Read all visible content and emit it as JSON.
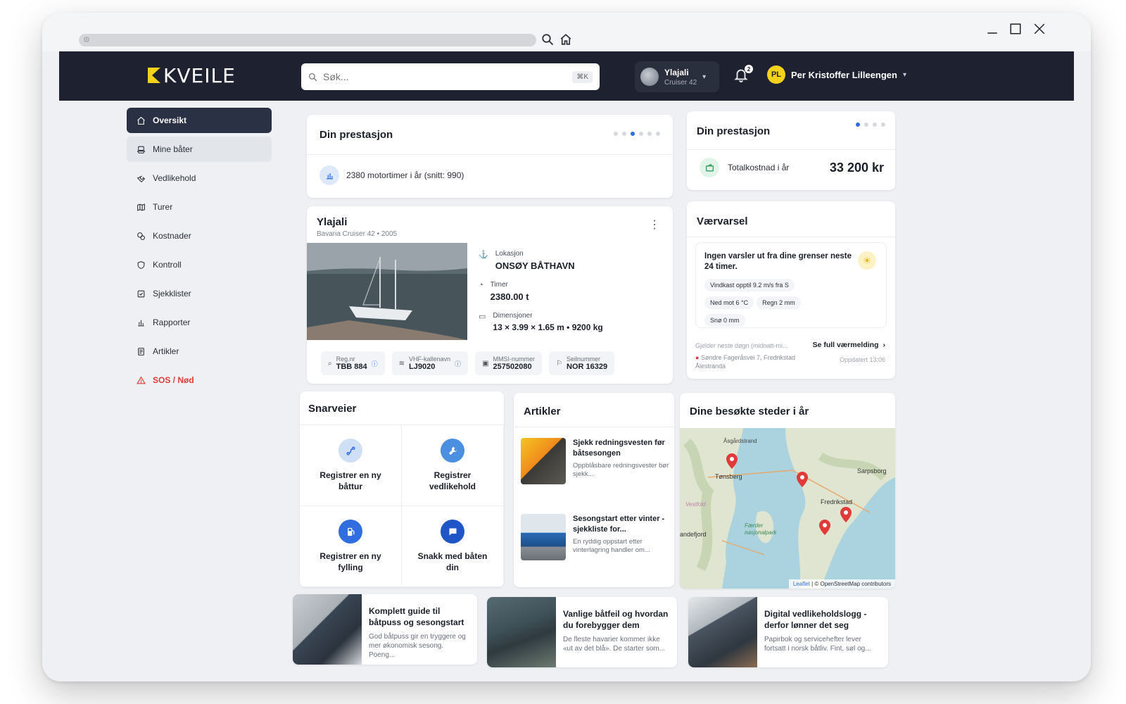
{
  "app": {
    "logo_text": "KVEILE",
    "search_placeholder": "Søk...",
    "search_shortcut": "⌘K",
    "boat_switch": {
      "name": "Ylajali",
      "model": "Cruiser 42"
    },
    "notifications_count": "2",
    "user": {
      "initials": "PL",
      "name": "Per Kristoffer Lilleengen"
    }
  },
  "sidebar": {
    "items": [
      {
        "label": "Oversikt",
        "icon": "home-icon"
      },
      {
        "label": "Mine båter",
        "icon": "boat-icon"
      },
      {
        "label": "Vedlikehold",
        "icon": "wrench-icon"
      },
      {
        "label": "Turer",
        "icon": "map-icon"
      },
      {
        "label": "Kostnader",
        "icon": "coins-icon"
      },
      {
        "label": "Kontroll",
        "icon": "shield-icon"
      },
      {
        "label": "Sjekklister",
        "icon": "checklist-icon"
      },
      {
        "label": "Rapporter",
        "icon": "chart-icon"
      },
      {
        "label": "Artikler",
        "icon": "article-icon"
      },
      {
        "label": "SOS / Nød",
        "icon": "warning-icon"
      }
    ]
  },
  "performance_left": {
    "title": "Din prestasjon",
    "text": "2380 motortimer i år (snitt: 990)",
    "dots_total": 6,
    "dots_active": 3
  },
  "performance_right": {
    "title": "Din prestasjon",
    "label": "Totalkostnad i år",
    "value": "33 200 kr",
    "dots_total": 4,
    "dots_active": 1
  },
  "boat": {
    "name": "Ylajali",
    "subtitle": "Bavaria Cruiser 42 • 2005",
    "location_label": "Lokasjon",
    "location_value": "ONSØY BÅTHAVN",
    "hours_label": "Timer",
    "hours_value": "2380.00 t",
    "dims_label": "Dimensjoner",
    "dims_value": "13 × 3.99 × 1.65 m • 9200 kg",
    "pills": [
      {
        "label": "Reg.nr",
        "value": "TBB 884"
      },
      {
        "label": "VHF-kallenavn",
        "value": "LJ9020"
      },
      {
        "label": "MMSI-nummer",
        "value": "257502080"
      },
      {
        "label": "Seilnummer",
        "value": "NOR 16329"
      }
    ]
  },
  "weather": {
    "title": "Værvarsel",
    "headline": "Ingen varsler ut fra dine grenser neste 24 timer.",
    "chips": [
      "Vindkast opptil 9.2 m/s fra S",
      "Ned mot 6 °C",
      "Regn 2 mm",
      "Snø 0 mm"
    ],
    "footnote": "Gjelder neste døgn (midnatt-mi...",
    "link": "Se full værmelding",
    "address": "Søndre Fageråsvei 7, Fredrikstad",
    "address2": "Ålestranda",
    "updated": "Oppdatert 13:06"
  },
  "shortcuts": {
    "title": "Snarveier",
    "items": [
      {
        "label": "Registrer en ny båttur",
        "icon": "route-icon",
        "color": "#cfe0f6"
      },
      {
        "label": "Registrer vedlikehold",
        "icon": "wrench-icon",
        "color": "#4a8fe0"
      },
      {
        "label": "Registrer en ny fylling",
        "icon": "fuel-icon",
        "color": "#2f6de1"
      },
      {
        "label": "Snakk med båten din",
        "icon": "chat-icon",
        "color": "#1f55c7"
      }
    ]
  },
  "articles": {
    "title": "Artikler",
    "items": [
      {
        "title": "Sjekk redningsvesten før båtsesongen",
        "summary": "Oppblåsbare redningsvester bør sjekk..."
      },
      {
        "title": "Sesongstart etter vinter - sjekkliste for...",
        "summary": "En ryddig oppstart etter vinterlagring handler om..."
      }
    ]
  },
  "places": {
    "title": "Dine besøkte steder i år",
    "labels": [
      "Åsgårdstrand",
      "Tønsberg",
      "Sarpsborg",
      "Fredrikstad",
      "Vestfold",
      "Færder nasjonalpark",
      "andefjord"
    ],
    "attribution_leaflet": "Leaflet",
    "attribution_rest": "| © OpenStreetMap contributors"
  },
  "bottom_articles": [
    {
      "title": "Komplett guide til båtpuss og sesongstart",
      "summary": "God båtpuss gir en tryggere og mer økonomisk sesong. Poeng..."
    },
    {
      "title": "Vanlige båtfeil og hvordan du forebygger dem",
      "summary": "De fleste havarier kommer ikke «ut av det blå». De starter som..."
    },
    {
      "title": "Digital vedlikeholdslogg - derfor lønner det seg",
      "summary": "Papirbok og servicehefter lever fortsatt i norsk båtliv. Fint, søl og..."
    }
  ],
  "colors": {
    "topbar": "#1e2230",
    "accent": "#2f6de1",
    "sidebar_active": "#2a3145",
    "sos": "#e03a3a",
    "avatar": "#f2d21a"
  }
}
